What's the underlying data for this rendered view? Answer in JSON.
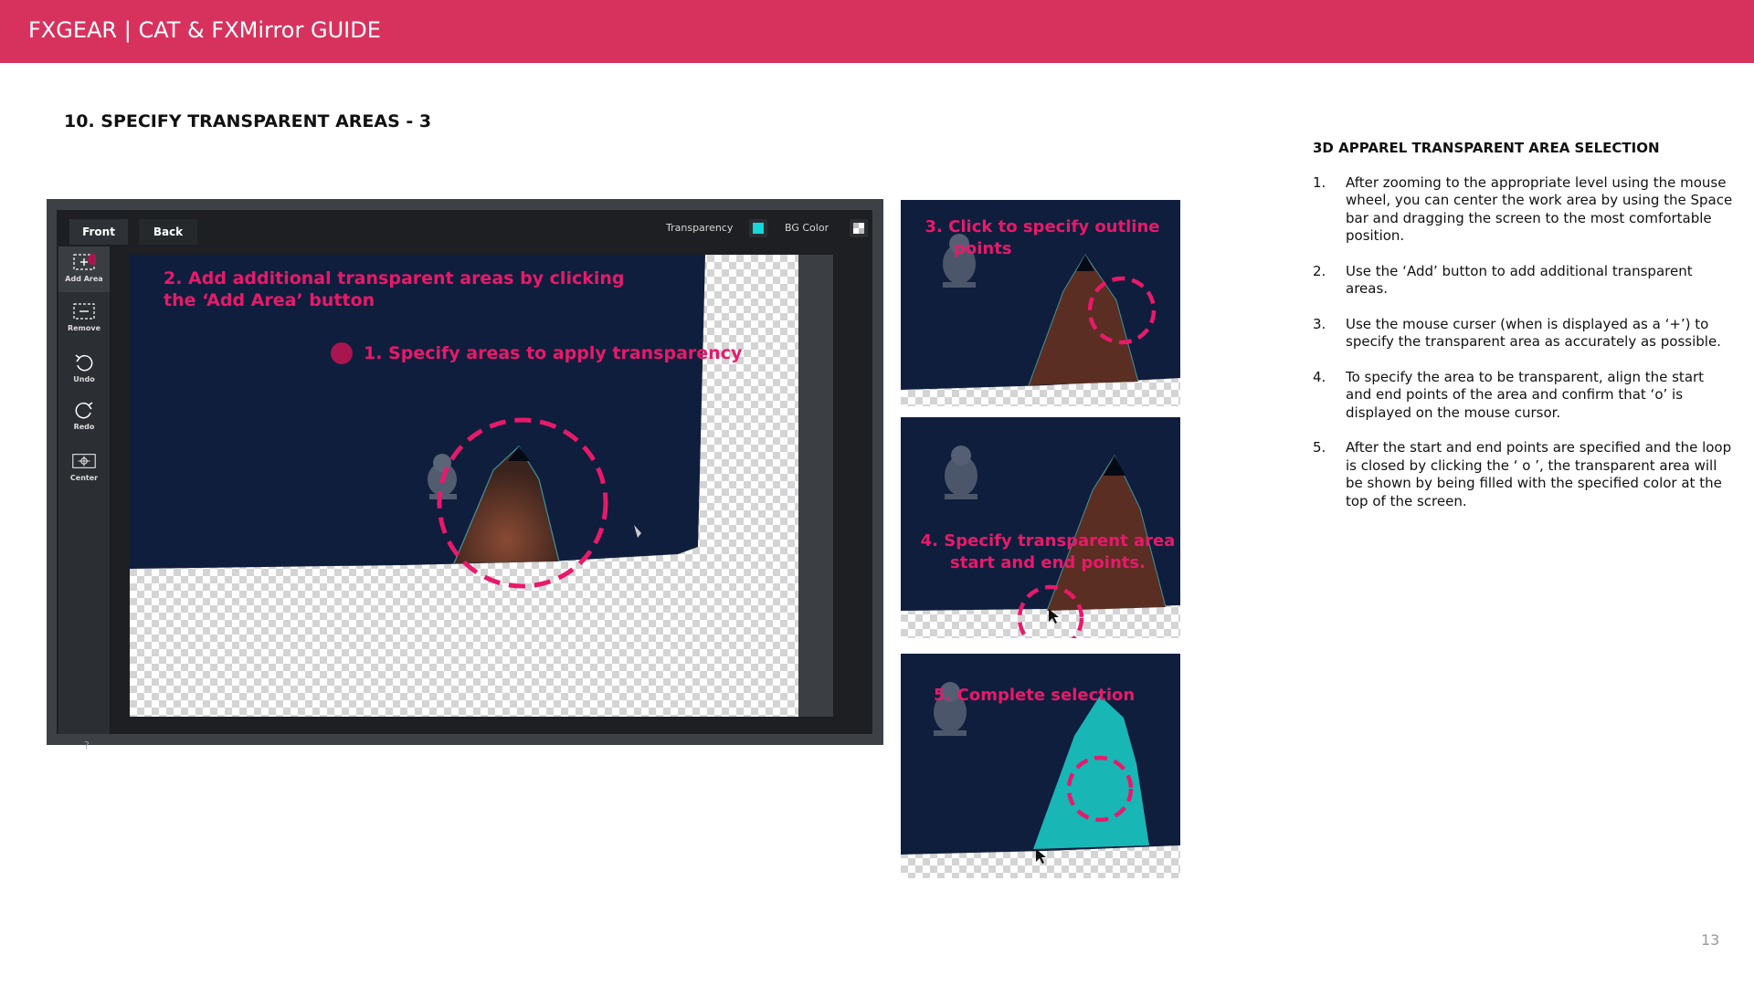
{
  "header": {
    "title": "FXGEAR | CAT & FXMirror GUIDE"
  },
  "section_title": "10. SPECIFY TRANSPARENT AREAS - 3",
  "app": {
    "tabs": [
      "Front",
      "Back"
    ],
    "transparency_label": "Transparency",
    "bg_color_label": "BG Color",
    "tools": [
      "Add Area",
      "Remove",
      "Undo",
      "Redo",
      "Center"
    ],
    "help_label": "?",
    "accent_color": "#16d8d8"
  },
  "callouts": {
    "add_area": [
      "2. Add additional transparent areas by clicking",
      "the ‘Add Area’ button"
    ],
    "specify_areas": "1. Specify areas to apply transparency"
  },
  "panels": {
    "outline": [
      "3. Click to specify outline",
      "points"
    ],
    "start_end": [
      "4. Specify transparent area",
      "start and end points."
    ],
    "complete": "5. Complete selection"
  },
  "instructions": {
    "title": "3D APPAREL TRANSPARENT AREA SELECTION",
    "steps": [
      {
        "num": "1.",
        "text": "After zooming to the appropriate level using the mouse wheel, you can center the work area by using the Space bar and dragging the screen to the most comfortable position."
      },
      {
        "num": "2.",
        "text": "Use the ‘Add’ button to add additional transparent areas."
      },
      {
        "num": "3.",
        "text": "Use the mouse curser (when is displayed as a ‘+’) to specify the transparent area as accurately as possible."
      },
      {
        "num": "4.",
        "text": "To specify the area to be transparent, align the start and end points of the area and confirm that ‘o’ is displayed on the mouse cursor."
      },
      {
        "num": "5.",
        "text": "After the start and end points are specified and the loop is closed by clicking the ‘ o ’, the transparent area will be shown by being filled with the specified color at the top of the screen."
      }
    ]
  },
  "page_number": "13",
  "colors": {
    "brand": "#d7325e",
    "highlight": "#e8196b",
    "garment": "#0f1e3c"
  }
}
